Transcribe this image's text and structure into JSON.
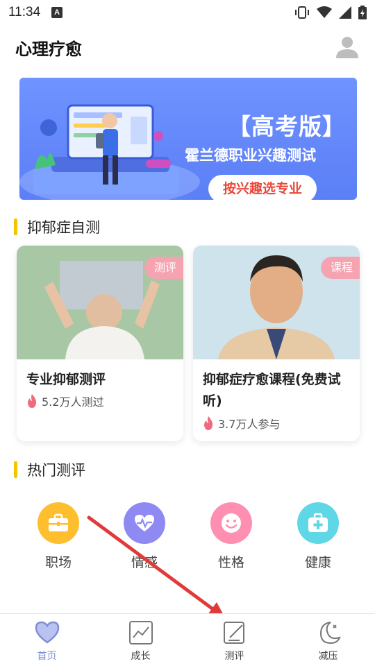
{
  "status": {
    "time": "11:34",
    "notif_letter": "A"
  },
  "header": {
    "title": "心理疗愈"
  },
  "banner": {
    "title": "【高考版】",
    "subtitle": "霍兰德职业兴趣测试",
    "button": "按兴趣选专业"
  },
  "sections": {
    "depression": "抑郁症自测",
    "hot": "热门测评"
  },
  "cards": [
    {
      "tag": "测评",
      "title": "专业抑郁测评",
      "meta": "5.2万人测过"
    },
    {
      "tag": "课程",
      "title": "抑郁症疗愈课程(免费试听)",
      "meta": "3.7万人参与"
    }
  ],
  "categories": [
    {
      "label": "职场",
      "icon": "briefcase-icon",
      "color": "#ffbe2e"
    },
    {
      "label": "情感",
      "icon": "heartbeat-icon",
      "color": "#8e89f3"
    },
    {
      "label": "性格",
      "icon": "smiley-icon",
      "color": "#ff8fb1"
    },
    {
      "label": "健康",
      "icon": "medkit-icon",
      "color": "#5fd7e6"
    }
  ],
  "nav": [
    {
      "label": "首页",
      "icon": "heart-icon",
      "active": true
    },
    {
      "label": "成长",
      "icon": "growth-chart-icon"
    },
    {
      "label": "测评",
      "icon": "edit-icon"
    },
    {
      "label": "减压",
      "icon": "moon-icon"
    }
  ],
  "colors": {
    "accent": "#7e8fd4",
    "section_bar": "#f2c500",
    "tag": "#f5a3b1",
    "arrow": "#e03a3a"
  }
}
